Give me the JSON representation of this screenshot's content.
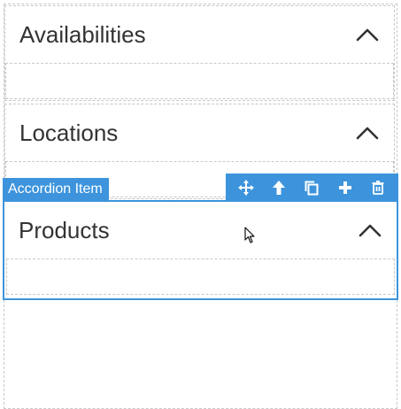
{
  "accordion": {
    "items": [
      {
        "title": "Availabilities"
      },
      {
        "title": "Locations"
      },
      {
        "title": "Products"
      }
    ],
    "selected_tag": "Accordion Item"
  },
  "toolbar": {
    "buttons": [
      "move-icon",
      "arrow-up-icon",
      "duplicate-icon",
      "add-icon",
      "trash-icon"
    ]
  },
  "colors": {
    "accent": "#3d94dc",
    "text": "#333333",
    "dashed_border": "#c9c9c9"
  }
}
